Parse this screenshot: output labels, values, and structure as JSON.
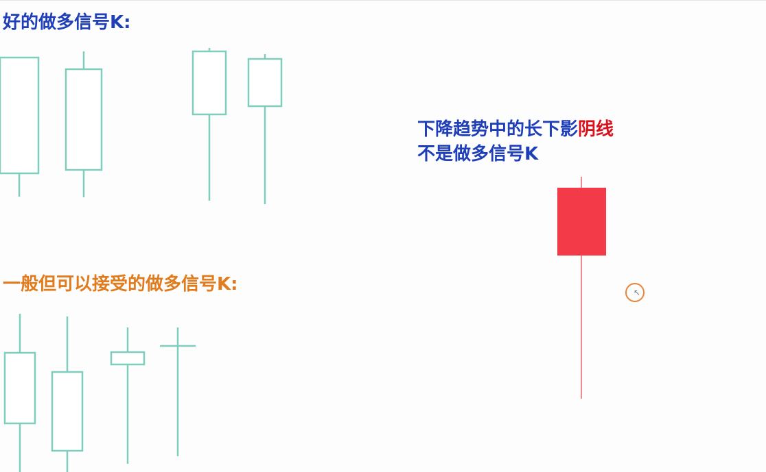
{
  "labels": {
    "good_title": "好的做多信号K:",
    "acceptable_title": "一般但可以接受的做多信号K:",
    "note_line1_main": "下降趋势中的长下影",
    "note_line1_highlight": "阴线",
    "note_line2": "不是做多信号K"
  },
  "colors": {
    "good_title": "#1f3fb8",
    "acceptable_title": "#e07b1e",
    "note_main": "#1f3fb8",
    "note_highlight": "#d9111c",
    "candle_outline": "#7ecdbd",
    "bearish_body": "#f23a49",
    "bearish_wick": "#f08a93",
    "cursor_ring": "#e8833a"
  },
  "icons": {
    "cursor": "mouse-pointer-icon"
  }
}
